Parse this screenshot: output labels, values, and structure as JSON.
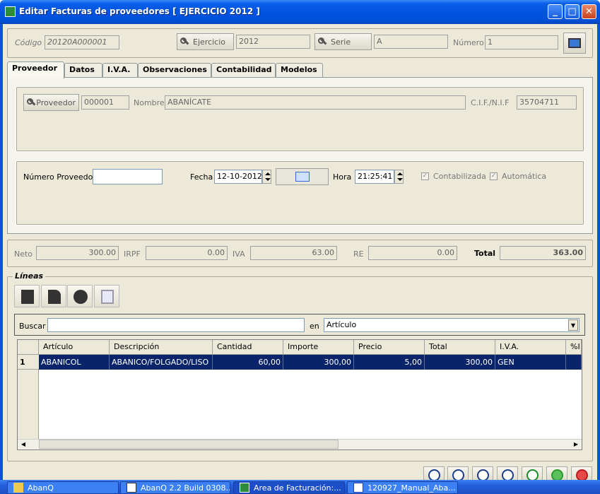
{
  "window": {
    "title": "Editar Facturas de proveedores [ EJERCICIO 2012 ]",
    "minimize": "_",
    "maximize": "□",
    "close": "✕"
  },
  "header": {
    "codigo_label": "Código",
    "codigo_value": "20120A000001",
    "ejercicio_button": "Ejercicio",
    "ejercicio_value": "2012",
    "serie_button": "Serie",
    "serie_value": "A",
    "numero_label": "Número",
    "numero_value": "1"
  },
  "tabs": [
    "Proveedor",
    "Datos",
    "I.V.A.",
    "Observaciones",
    "Contabilidad",
    "Modelos"
  ],
  "proveedor": {
    "proveedor_button": "Proveedor",
    "proveedor_value": "000001",
    "nombre_label": "Nombre",
    "nombre_value": "ABANÍCATE",
    "cif_label": "C.I.F./N.I.F",
    "cif_value": "35704711"
  },
  "datos": {
    "numero_proveedor_label": "Número Proveedor",
    "numero_proveedor_value": "",
    "fecha_label": "Fecha",
    "fecha_value": "12-10-2012",
    "hora_label": "Hora",
    "hora_value": "21:25:41",
    "contabilizada_label": "Contabilizada",
    "automatica_label": "Automática"
  },
  "totals": {
    "neto_label": "Neto",
    "neto_value": "300.00",
    "irpf_label": "IRPF",
    "irpf_value": "0.00",
    "iva_label": "IVA",
    "iva_value": "63.00",
    "re_label": "RE",
    "re_value": "0.00",
    "total_label": "Total",
    "total_value": "363.00"
  },
  "lineas": {
    "title": "Líneas",
    "buscar_label": "Buscar",
    "buscar_value": "",
    "en_label": "en",
    "en_value": "Artículo",
    "columns": [
      "Artículo",
      "Descripción",
      "Cantidad",
      "Importe",
      "Precio",
      "Total",
      "I.V.A.",
      "%I"
    ],
    "rows": [
      {
        "num": "1",
        "articulo": "ABANICOL",
        "descripcion": "ABANICO/FOLGADO/LISO",
        "cantidad": "60,00",
        "importe": "300,00",
        "precio": "5,00",
        "total": "300,00",
        "iva": "GEN",
        "pct": ""
      }
    ]
  },
  "taskbar": {
    "tasks": [
      "AbanQ",
      "AbanQ 2.2 Build 0308...",
      "Area de Facturación:...",
      "120927_Manual_Aba..."
    ]
  }
}
